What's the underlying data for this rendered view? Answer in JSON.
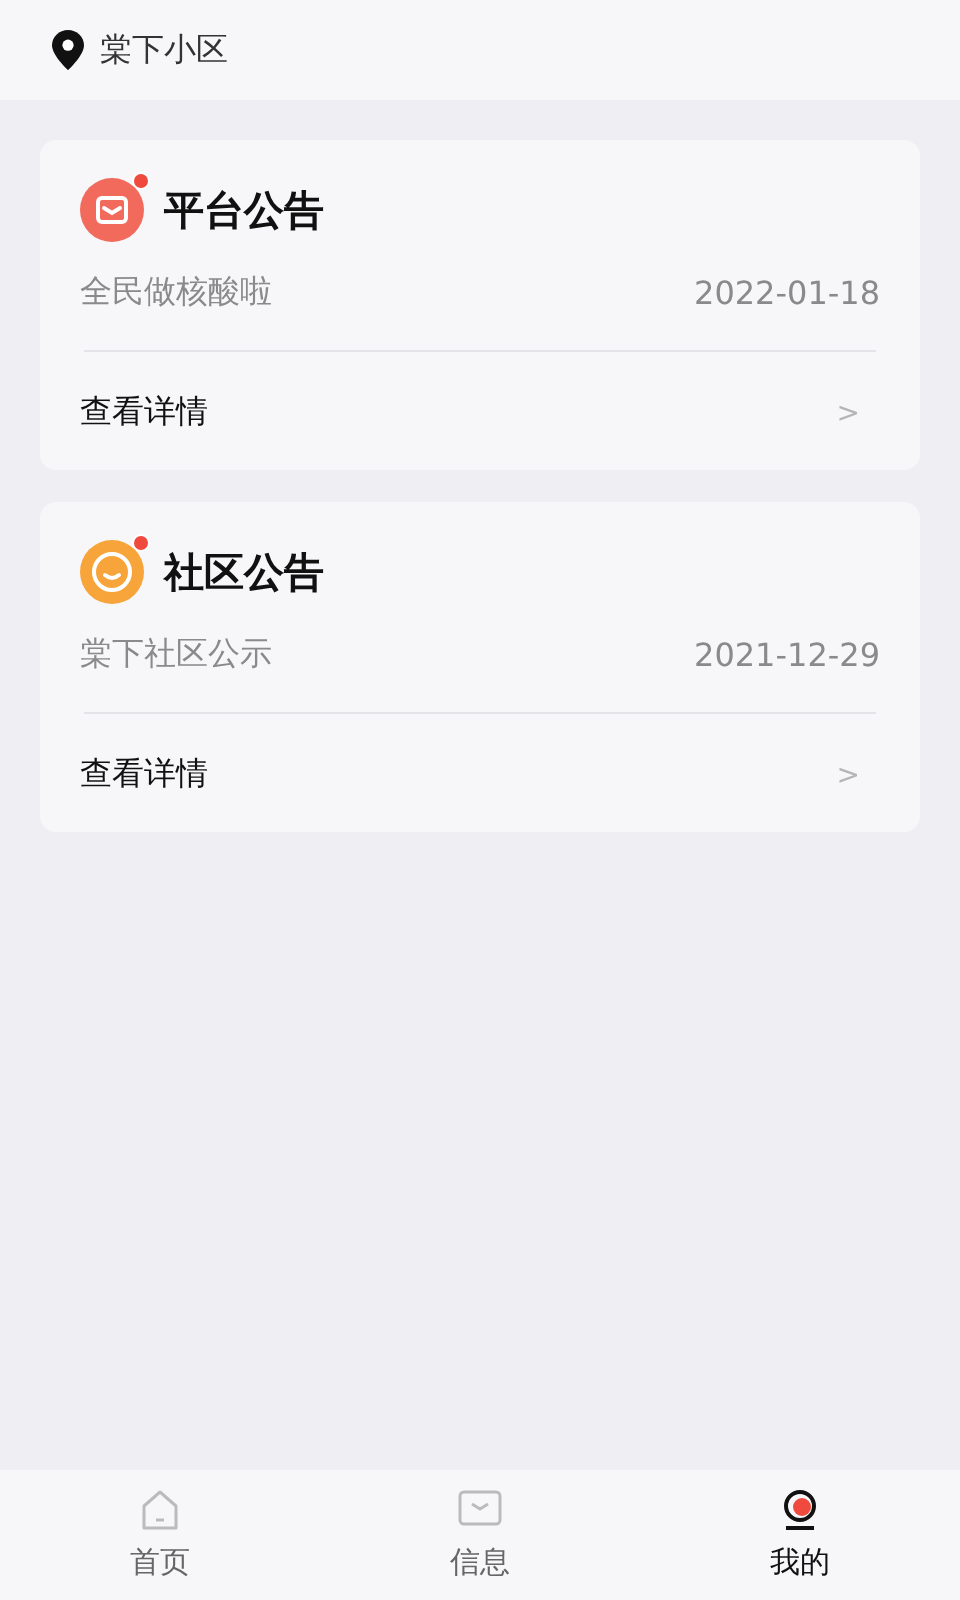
{
  "location": {
    "name": "棠下小区"
  },
  "notices": [
    {
      "kind": "mail",
      "title": "平台公告",
      "summary": "全民做核酸啦",
      "date": "2022-01-18",
      "action": "查看详情",
      "arrow": ">",
      "unread": true
    },
    {
      "kind": "smile",
      "title": "社区公告",
      "summary": "棠下社区公示",
      "date": "2021-12-29",
      "action": "查看详情",
      "arrow": ">",
      "unread": true
    }
  ],
  "tab_bar": [
    {
      "kind": "home",
      "label": "首页",
      "selected": false
    },
    {
      "kind": "mail",
      "label": "信息",
      "selected": false
    },
    {
      "kind": "profile",
      "label": "我的",
      "selected": true
    }
  ]
}
